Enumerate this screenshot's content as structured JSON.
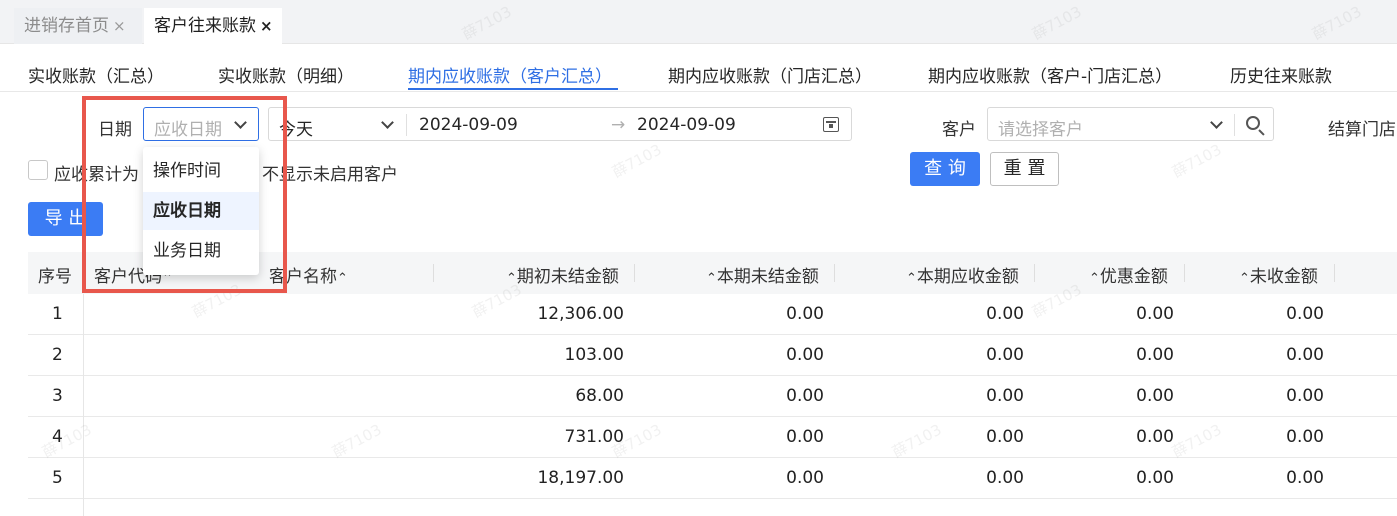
{
  "page_tabs": [
    {
      "label": "进销存首页",
      "close": "×"
    },
    {
      "label": "客户往来账款",
      "close": "×"
    }
  ],
  "sub_tabs": [
    {
      "label": "实收账款（汇总）"
    },
    {
      "label": "实收账款（明细）"
    },
    {
      "label": "期内应收账款（客户汇总）"
    },
    {
      "label": "期内应收账款（门店汇总）"
    },
    {
      "label": "期内应收账款（客户-门店汇总）"
    },
    {
      "label": "历史往来账款"
    }
  ],
  "filters": {
    "date_label": "日期",
    "date_type_value": "应收日期",
    "date_range_preset": "今天",
    "start_date": "2024-09-09",
    "end_date": "2024-09-09",
    "range_arrow": "→",
    "customer_label": "客户",
    "customer_placeholder": "请选择客户",
    "store_label": "结算门店",
    "cumulative_checkbox_label": "应收累计为",
    "hide_inactive_label": "不显示未启用客户",
    "query_button": "查 询",
    "reset_button": "重 置"
  },
  "dropdown": {
    "options": [
      "操作时间",
      "应收日期",
      "业务日期"
    ],
    "selected": "应收日期"
  },
  "toolbar": {
    "export_button": "导 出"
  },
  "table": {
    "columns": [
      "序号",
      "客户代码",
      "客户名称",
      "期初未结金额",
      "本期未结金额",
      "本期应收金额",
      "优惠金额",
      "未收金额"
    ],
    "rows": [
      {
        "no": "1",
        "code": "",
        "name": "",
        "opening": "12,306.00",
        "period_unsettled": "0.00",
        "period_receivable": "0.00",
        "discount": "0.00",
        "unreceived": "0.00"
      },
      {
        "no": "2",
        "code": "",
        "name": "",
        "opening": "103.00",
        "period_unsettled": "0.00",
        "period_receivable": "0.00",
        "discount": "0.00",
        "unreceived": "0.00"
      },
      {
        "no": "3",
        "code": "",
        "name": "",
        "opening": "68.00",
        "period_unsettled": "0.00",
        "period_receivable": "0.00",
        "discount": "0.00",
        "unreceived": "0.00"
      },
      {
        "no": "4",
        "code": "",
        "name": "",
        "opening": "731.00",
        "period_unsettled": "0.00",
        "period_receivable": "0.00",
        "discount": "0.00",
        "unreceived": "0.00"
      },
      {
        "no": "5",
        "code": "",
        "name": "",
        "opening": "18,197.00",
        "period_unsettled": "0.00",
        "period_receivable": "0.00",
        "discount": "0.00",
        "unreceived": "0.00"
      }
    ]
  },
  "watermark": "薛7103",
  "colors": {
    "accent": "#2f6fe4",
    "primary_button": "#3b7cf4",
    "highlight_box": "#e8574c"
  }
}
